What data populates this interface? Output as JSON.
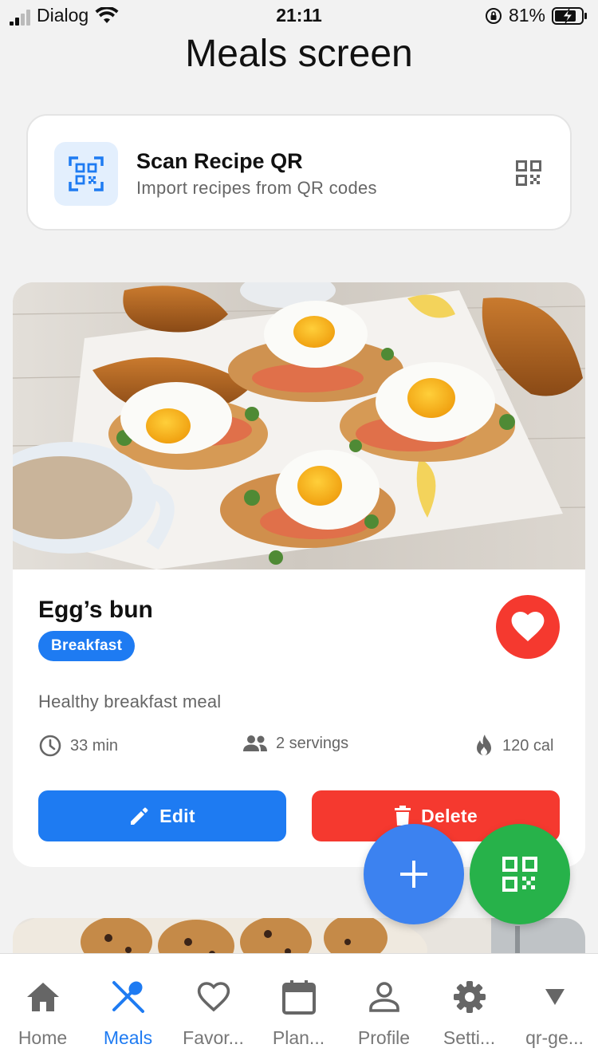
{
  "status_bar": {
    "carrier": "Dialog",
    "time": "21:11",
    "battery": "81%"
  },
  "page": {
    "title": "Meals screen"
  },
  "qr_card": {
    "title": "Scan Recipe QR",
    "subtitle": "Import recipes from QR codes",
    "icon": "qr-scan-icon",
    "accent": "#1e7bf2"
  },
  "meal": {
    "name": "Egg’s bun",
    "category": "Breakfast",
    "description": "Healthy breakfast meal",
    "time": "33 min",
    "servings": "2 servings",
    "calories": "120 cal",
    "edit_label": "Edit",
    "delete_label": "Delete",
    "favorite": true
  },
  "tabs": [
    {
      "label": "Home",
      "icon": "home-icon",
      "active": false
    },
    {
      "label": "Meals",
      "icon": "fork-knife-icon",
      "active": true
    },
    {
      "label": "Favor...",
      "icon": "heart-outline-icon",
      "active": false
    },
    {
      "label": "Plan...",
      "icon": "calendar-icon",
      "active": false
    },
    {
      "label": "Profile",
      "icon": "person-icon",
      "active": false
    },
    {
      "label": "Setti...",
      "icon": "gear-icon",
      "active": false
    },
    {
      "label": "qr-ge...",
      "icon": "triangle-down-icon",
      "active": false
    }
  ],
  "colors": {
    "primary": "#1e7bf2",
    "danger": "#f5392f",
    "success": "#27b24a",
    "fab_add": "#3c82f0",
    "background": "#f2f2f2"
  }
}
